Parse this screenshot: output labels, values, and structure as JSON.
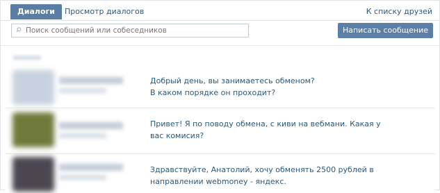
{
  "tabs": {
    "active": "Диалоги",
    "view": "Просмотр диалогов",
    "friends": "К списку друзей"
  },
  "search": {
    "placeholder": "Поиск сообщений или собеседников",
    "icon": "search-icon"
  },
  "actions": {
    "write_message": "Написать сообщение"
  },
  "colors": {
    "accent": "#597da3",
    "link": "#2b587a",
    "border": "#dfe3e8"
  },
  "dialogs": [
    {
      "lines": [
        "Добрый день, вы занимаетесь обменом?",
        "В каком порядке он проходит?"
      ]
    },
    {
      "lines": [
        "Привет! Я по поводу обмена, с киви на вебмани. Какая у",
        "вас комисия?"
      ]
    },
    {
      "lines": [
        "Здравствуйте, Анатолий, хочу обменять 2500 рублей в",
        "направлении webmoney - яндекс."
      ]
    }
  ]
}
